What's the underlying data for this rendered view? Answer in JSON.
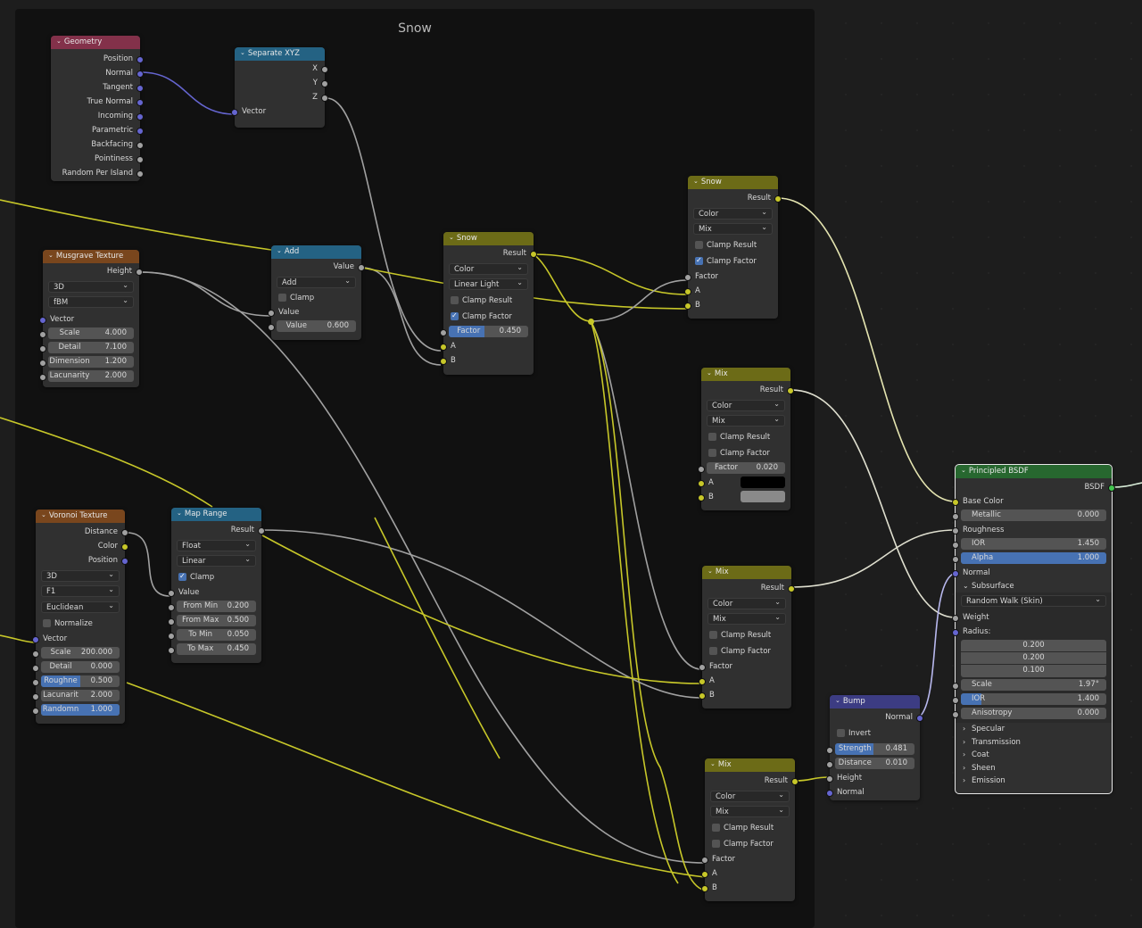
{
  "frame": {
    "title": "Snow"
  },
  "colors": {
    "header_input": "#83314a",
    "header_converter": "#246283",
    "header_texture": "#79461d",
    "header_color": "#6c6b17",
    "header_vector": "#3c3c83",
    "header_shader": "#27672f",
    "socket_vector": "#6565d0",
    "socket_float": "#a1a1a1",
    "socket_color": "#c7c729",
    "socket_shader": "#42c44f",
    "accent": "#4772b3"
  },
  "nodes": {
    "geometry": {
      "title": "Geometry",
      "outputs": [
        "Position",
        "Normal",
        "Tangent",
        "True Normal",
        "Incoming",
        "Parametric",
        "Backfacing",
        "Pointiness",
        "Random Per Island"
      ]
    },
    "separate_xyz": {
      "title": "Separate XYZ",
      "outputs": [
        "X",
        "Y",
        "Z"
      ],
      "input": "Vector"
    },
    "musgrave": {
      "title": "Musgrave Texture",
      "output": "Height",
      "dimensions": "3D",
      "type": "fBM",
      "vector_label": "Vector",
      "fields": [
        {
          "label": "Scale",
          "value": "4.000"
        },
        {
          "label": "Detail",
          "value": "7.100"
        },
        {
          "label": "Dimension",
          "value": "1.200"
        },
        {
          "label": "Lacunarity",
          "value": "2.000"
        }
      ]
    },
    "add": {
      "title": "Add",
      "output": "Value",
      "operation": "Add",
      "clamp_label": "Clamp",
      "clamp": false,
      "input_label": "Value",
      "field_label": "Value",
      "field_value": "0.600"
    },
    "snow1": {
      "title": "Snow",
      "output": "Result",
      "data_type": "Color",
      "blend": "Linear Light",
      "clamp_result_label": "Clamp Result",
      "clamp_result": false,
      "clamp_factor_label": "Clamp Factor",
      "clamp_factor": true,
      "factor_label": "Factor",
      "factor_value": "0.450",
      "factor_fraction": 0.45,
      "inputs": [
        "A",
        "B"
      ]
    },
    "snow2": {
      "title": "Snow",
      "output": "Result",
      "data_type": "Color",
      "blend": "Mix",
      "clamp_result_label": "Clamp Result",
      "clamp_result": false,
      "clamp_factor_label": "Clamp Factor",
      "clamp_factor": true,
      "inputs": [
        "Factor",
        "A",
        "B"
      ]
    },
    "mix1": {
      "title": "Mix",
      "output": "Result",
      "data_type": "Color",
      "blend": "Mix",
      "clamp_result_label": "Clamp Result",
      "clamp_factor_label": "Clamp Factor",
      "factor_label": "Factor",
      "factor_value": "0.020",
      "inputs": [
        "A",
        "B"
      ],
      "color_a": "#000000",
      "color_b": "#8a8a8a"
    },
    "mix2": {
      "title": "Mix",
      "output": "Result",
      "data_type": "Color",
      "blend": "Mix",
      "clamp_result_label": "Clamp Result",
      "clamp_factor_label": "Clamp Factor",
      "inputs": [
        "Factor",
        "A",
        "B"
      ]
    },
    "mix3": {
      "title": "Mix",
      "output": "Result",
      "data_type": "Color",
      "blend": "Mix",
      "clamp_result_label": "Clamp Result",
      "clamp_factor_label": "Clamp Factor",
      "inputs": [
        "Factor",
        "A",
        "B"
      ]
    },
    "voronoi": {
      "title": "Voronoi Texture",
      "outputs": [
        "Distance",
        "Color",
        "Position"
      ],
      "dimensions": "3D",
      "feature": "F1",
      "metric": "Euclidean",
      "normalize_label": "Normalize",
      "vector_label": "Vector",
      "fields": [
        {
          "label": "Scale",
          "value": "200.000",
          "fraction": 0
        },
        {
          "label": "Detail",
          "value": "0.000",
          "fraction": 0
        },
        {
          "label": "Roughne",
          "value": "0.500",
          "fraction": 0.5
        },
        {
          "label": "Lacunarit",
          "value": "2.000",
          "fraction": 0
        },
        {
          "label": "Randomn",
          "value": "1.000",
          "fraction": 1.0
        }
      ]
    },
    "map_range": {
      "title": "Map Range",
      "output": "Result",
      "data_type": "Float",
      "interpolation": "Linear",
      "clamp_label": "Clamp",
      "clamp": true,
      "input_label": "Value",
      "fields": [
        {
          "label": "From Min",
          "value": "0.200"
        },
        {
          "label": "From Max",
          "value": "0.500"
        },
        {
          "label": "To Min",
          "value": "0.050"
        },
        {
          "label": "To Max",
          "value": "0.450"
        }
      ]
    },
    "bump": {
      "title": "Bump",
      "output": "Normal",
      "invert_label": "Invert",
      "strength_label": "Strength",
      "strength_value": "0.481",
      "strength_fraction": 0.481,
      "distance_label": "Distance",
      "distance_value": "0.010",
      "inputs": [
        "Height",
        "Normal"
      ]
    },
    "bsdf": {
      "title": "Principled BSDF",
      "output": "BSDF",
      "base_color": "Base Color",
      "metallic_label": "Metallic",
      "metallic_value": "0.000",
      "roughness": "Roughness",
      "ior_label": "IOR",
      "ior_value": "1.450",
      "alpha_label": "Alpha",
      "alpha_value": "1.000",
      "alpha_fraction": 1.0,
      "normal": "Normal",
      "subsurface_label": "Subsurface",
      "subsurface_method": "Random Walk (Skin)",
      "weight": "Weight",
      "radius_label": "Radius:",
      "radius": [
        "0.200",
        "0.200",
        "0.100"
      ],
      "scale_label": "Scale",
      "scale_value": "1.97°",
      "ss_ior_label": "IOR",
      "ss_ior_value": "1.400",
      "ss_ior_fraction": 0.14,
      "anisotropy_label": "Anisotropy",
      "anisotropy_value": "0.000",
      "panels": [
        "Specular",
        "Transmission",
        "Coat",
        "Sheen",
        "Emission"
      ]
    }
  }
}
